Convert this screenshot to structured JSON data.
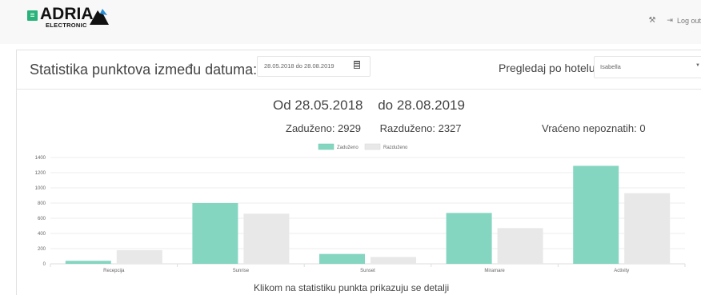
{
  "app": {
    "logo_text": "ADRIA",
    "logo_subtext": "ELECTRONIC",
    "logout_label": "Log out"
  },
  "header": {
    "title": "Statistika punktova između datuma:",
    "date_range": "28.05.2018 do 28.08.2019",
    "hotel_label": "Pregledaj po hotelu:",
    "hotel_selected": "Isabella"
  },
  "summary": {
    "from": "Od 28.05.2018",
    "to": "do 28.08.2019",
    "issued": "Zaduženo: 2929",
    "returned": "Razduženo: 2327",
    "unknown": "Vraćeno nepoznatih: 0"
  },
  "note": "Klikom na statistiku punkta prikazuju se detalji",
  "colors": {
    "accent": "#2ab27b",
    "series_issued": "#85d6c1",
    "series_returned": "#e8e8e8"
  },
  "chart_data": {
    "type": "bar",
    "categories": [
      "Recepcija",
      "Sunrise",
      "Sunset",
      "Miramare",
      "Activity"
    ],
    "series": [
      {
        "name": "Zaduženo",
        "values": [
          40,
          800,
          130,
          670,
          1290
        ]
      },
      {
        "name": "Razduženo",
        "values": [
          180,
          660,
          90,
          470,
          930
        ]
      }
    ],
    "title": "",
    "xlabel": "",
    "ylabel": "",
    "ylim": [
      0,
      1400
    ],
    "yticks": [
      0,
      200,
      400,
      600,
      800,
      1000,
      1200,
      1400
    ],
    "grid": true,
    "legend": "top-center"
  }
}
